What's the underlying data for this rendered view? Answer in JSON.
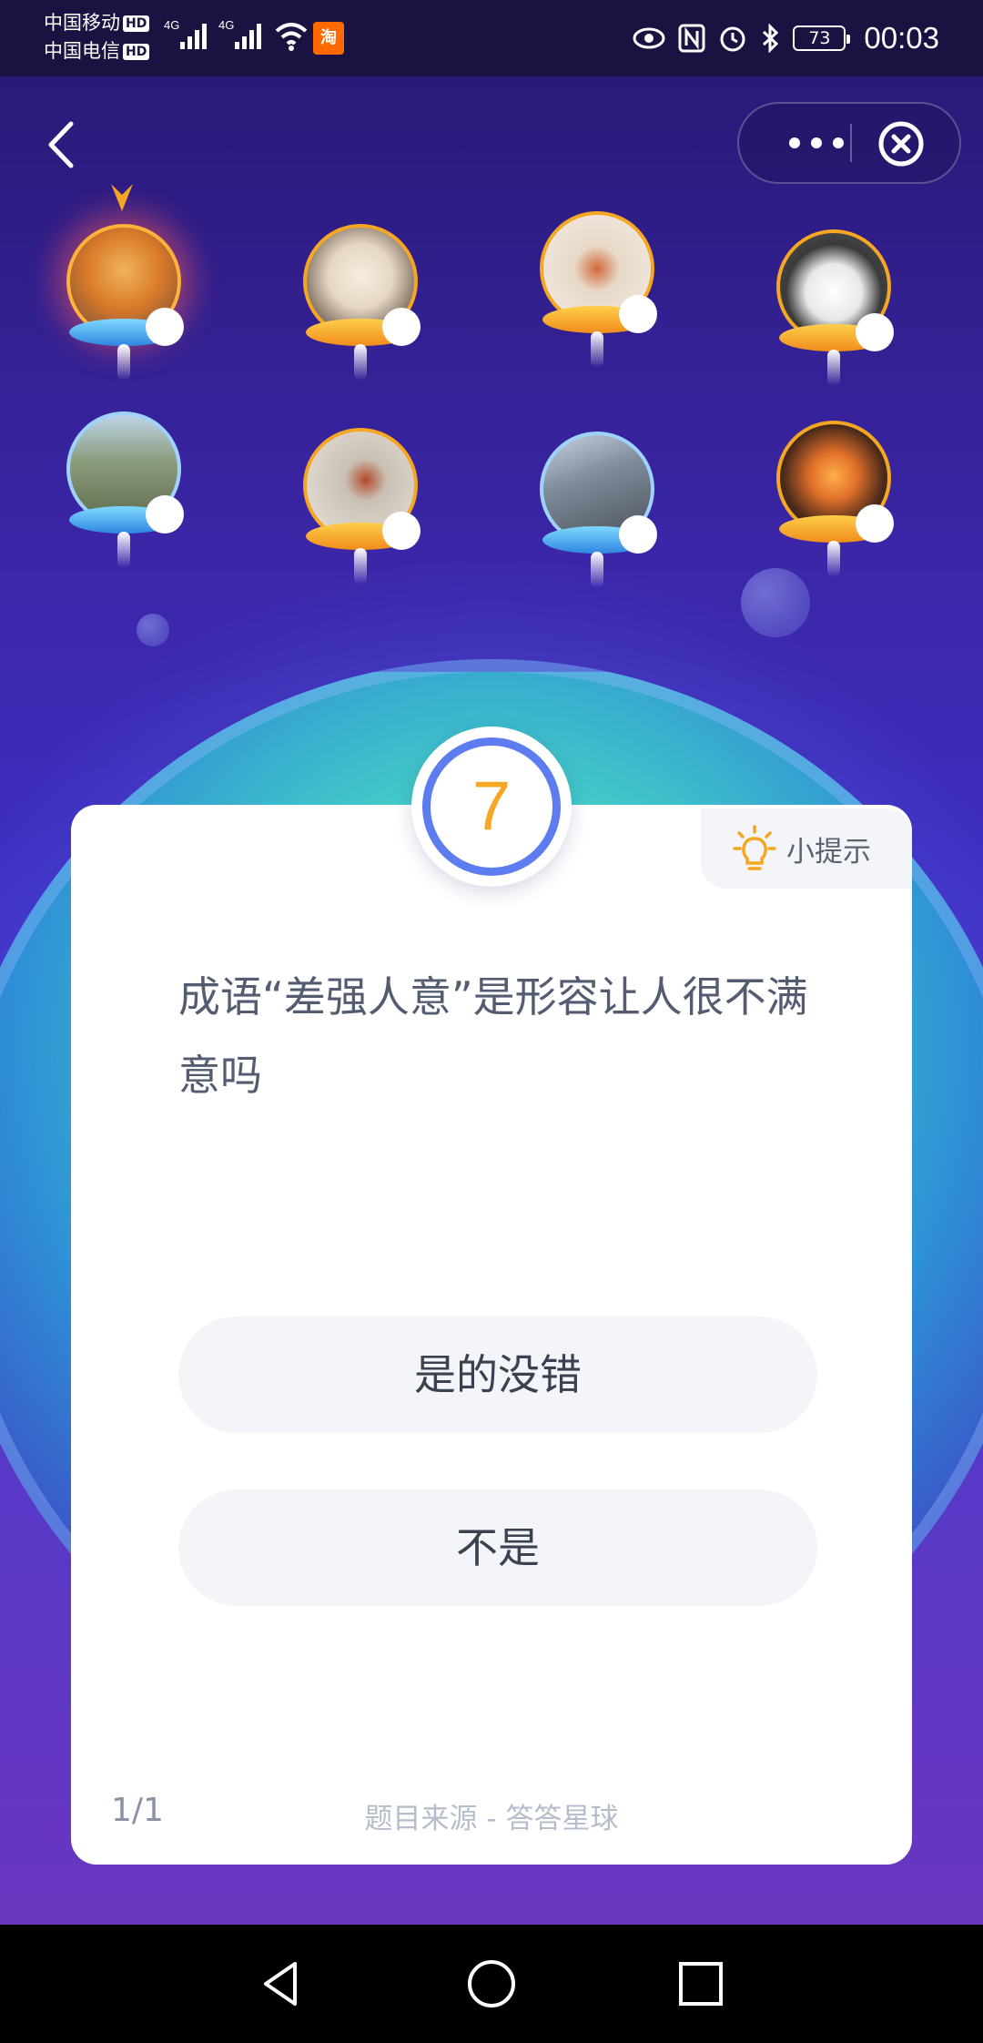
{
  "status_bar": {
    "carrier_1": "中国移动",
    "carrier_2": "中国电信",
    "hd_badge": "HD",
    "network_1": "4G",
    "network_2": "4G",
    "taobao_badge": "淘",
    "battery": "73",
    "time": "00:03"
  },
  "nav": {
    "back_icon": "chevron-left-icon",
    "more_icon": "more-dots-icon",
    "close_icon": "close-circle-icon"
  },
  "players": [
    {
      "slot": 1,
      "is_me": true
    },
    {
      "slot": 2,
      "is_me": false
    },
    {
      "slot": 3,
      "is_me": false
    },
    {
      "slot": 4,
      "is_me": false
    },
    {
      "slot": 5,
      "is_me": false
    },
    {
      "slot": 6,
      "is_me": false
    },
    {
      "slot": 7,
      "is_me": false
    },
    {
      "slot": 8,
      "is_me": false
    }
  ],
  "quiz": {
    "countdown": "7",
    "hint_label": "小提示",
    "question": "成语“差强人意”是形容让人很不满意吗",
    "options": [
      "是的没错",
      "不是"
    ],
    "progress": "1/1",
    "source": "题目来源 - 答答星球"
  },
  "colors": {
    "accent_orange": "#f5a623",
    "ring_blue": "#5d7cf0",
    "bg_purple": "#3f2fc4"
  }
}
